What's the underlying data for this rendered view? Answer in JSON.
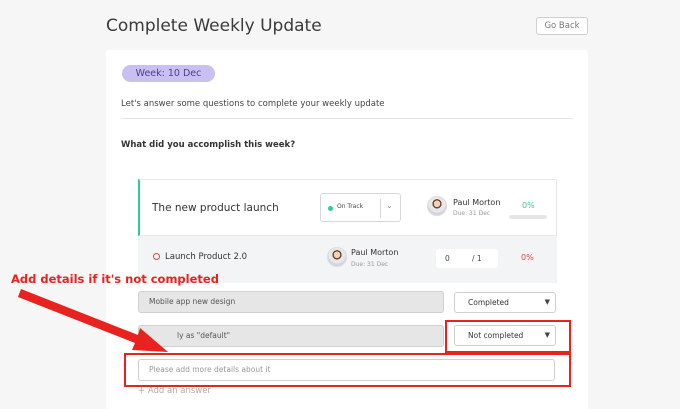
{
  "header": {
    "title": "Complete Weekly Update",
    "go_back": "Go Back"
  },
  "update": {
    "week": "Week: 10 Dec",
    "intro": "Let's answer some questions to complete your weekly update",
    "question": "What did you accomplish this week?"
  },
  "objective": {
    "title": "The new product launch",
    "status": "On Track",
    "owner": "Paul Morton",
    "due": "Due: 31 Dec",
    "progress": "0%",
    "progress_fraction": 0,
    "status_color": "#2ecc8e"
  },
  "key_result": {
    "title": "Launch Product 2.0",
    "owner": "Paul Morton",
    "due": "Due: 31 Dec",
    "current": "0",
    "target": "/ 1",
    "progress": "0%",
    "progress_color": "#e04848"
  },
  "answers": [
    {
      "text": "Mobile app new design",
      "status": "Completed"
    },
    {
      "text": "ly as \"default\"",
      "status": "Not completed"
    }
  ],
  "details": {
    "placeholder": "Please add more details about it"
  },
  "add_answer": "+ Add an answer",
  "annotation": {
    "text": "Add details if it's not completed",
    "color": "#e8231f"
  },
  "icons": {
    "status_dropdown": "chevron-down-icon",
    "select_dropdown": "chevron-down-icon",
    "kr_status": "circle-icon",
    "avatar": "user-avatar"
  }
}
